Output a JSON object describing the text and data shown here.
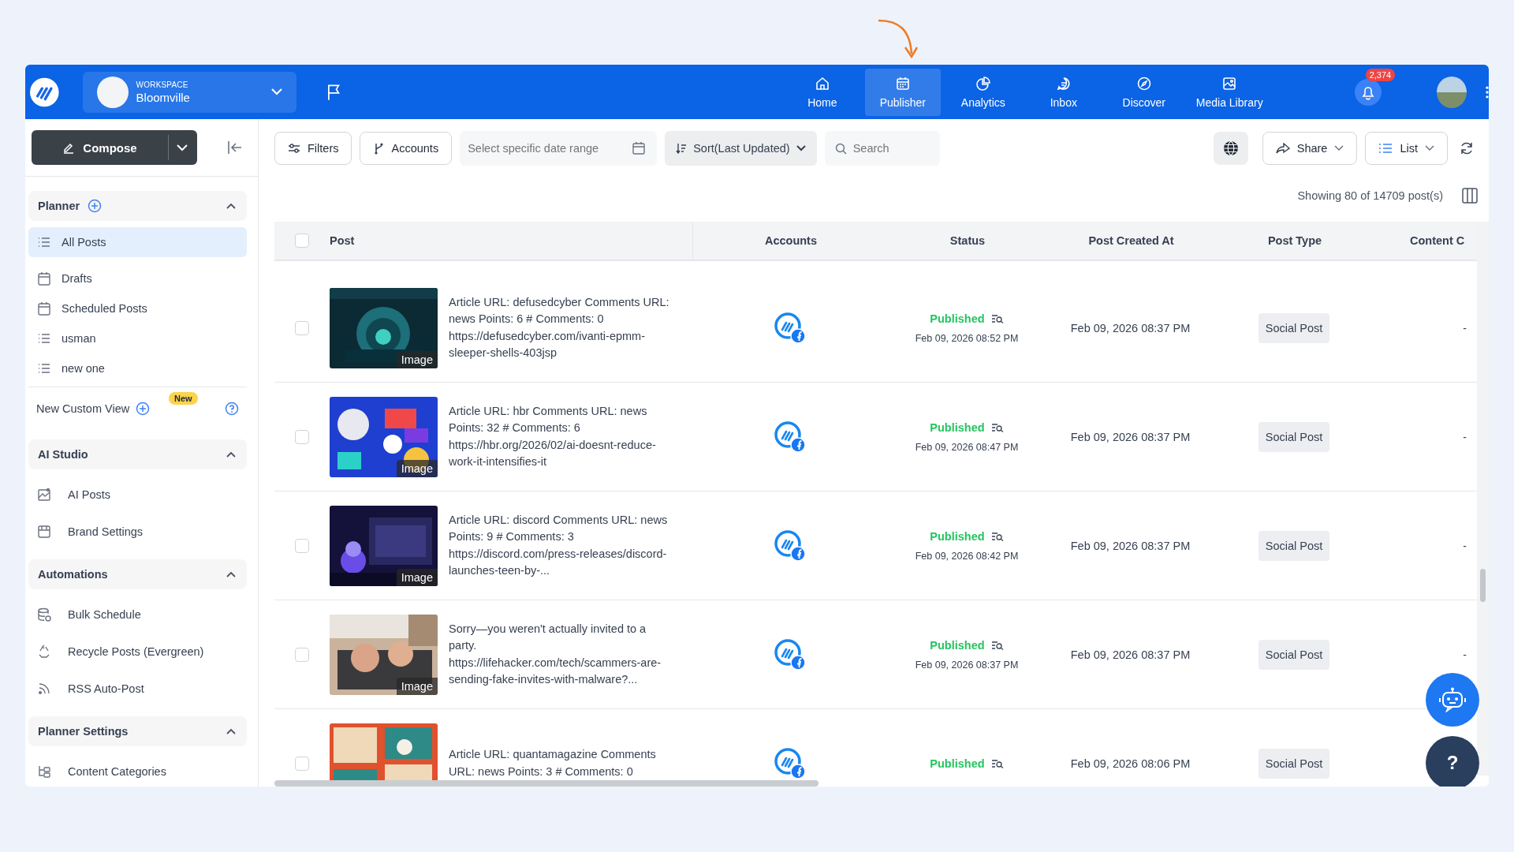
{
  "header": {
    "workspace_label": "WORKSPACE",
    "workspace_name": "Bloomville",
    "nav": [
      {
        "label": "Home",
        "selected": false
      },
      {
        "label": "Publisher",
        "selected": true
      },
      {
        "label": "Analytics",
        "selected": false
      },
      {
        "label": "Inbox",
        "selected": false
      },
      {
        "label": "Discover",
        "selected": false
      },
      {
        "label": "Media Library",
        "selected": false
      }
    ],
    "notification_count": "2,374"
  },
  "sidebar": {
    "compose": "Compose",
    "sections": [
      {
        "title": "Planner",
        "add": true,
        "expanded": true,
        "items": [
          {
            "label": "All Posts",
            "selected": true
          },
          {
            "label": "Drafts",
            "selected": false
          },
          {
            "label": "Scheduled Posts",
            "selected": false
          },
          {
            "label": "usman",
            "selected": false
          },
          {
            "label": "new one",
            "selected": false
          }
        ],
        "custom_view": {
          "label": "New Custom View",
          "badge": "New"
        }
      },
      {
        "title": "AI Studio",
        "add": false,
        "expanded": true,
        "items": [
          {
            "label": "AI Posts",
            "selected": false
          },
          {
            "label": "Brand Settings",
            "selected": false
          }
        ]
      },
      {
        "title": "Automations",
        "add": false,
        "expanded": true,
        "items": [
          {
            "label": "Bulk Schedule",
            "selected": false
          },
          {
            "label": "Recycle Posts (Evergreen)",
            "selected": false
          },
          {
            "label": "RSS Auto-Post",
            "selected": false
          }
        ]
      },
      {
        "title": "Planner Settings",
        "add": false,
        "expanded": true,
        "items": [
          {
            "label": "Content Categories",
            "selected": false
          }
        ]
      }
    ]
  },
  "toolbar": {
    "filters": "Filters",
    "accounts": "Accounts",
    "date_range": {
      "placeholder": "Select specific date range"
    },
    "sort": "Sort(Last Updated)",
    "search": {
      "placeholder": "Search"
    },
    "share": "Share",
    "view": "List"
  },
  "summary": "Showing 80 of 14709 post(s)",
  "table": {
    "select_all_checked": false,
    "columns": [
      "Post",
      "Accounts",
      "Status",
      "Post Created At",
      "Post Type",
      "Content C"
    ],
    "rows": [
      {
        "checked": false,
        "media_label": "Image",
        "text": "Article URL: defusedcyber Comments URL: news Points: 6 # Comments: 0 https://defusedcyber.com/ivanti-epmm-sleeper-shells-403jsp",
        "status": "Published",
        "status_time": "Feb 09, 2026 08:52 PM",
        "created_at": "Feb 09, 2026 08:37 PM",
        "post_type": "Social Post",
        "content_category": "-"
      },
      {
        "checked": false,
        "media_label": "Image",
        "text": "Article URL: hbr Comments URL: news Points: 32 # Comments: 6 https://hbr.org/2026/02/ai-doesnt-reduce-work-it-intensifies-it",
        "status": "Published",
        "status_time": "Feb 09, 2026 08:47 PM",
        "created_at": "Feb 09, 2026 08:37 PM",
        "post_type": "Social Post",
        "content_category": "-"
      },
      {
        "checked": false,
        "media_label": "Image",
        "text": "Article URL: discord Comments URL: news Points: 9 # Comments: 3 https://discord.com/press-releases/discord-launches-teen-by-...",
        "status": "Published",
        "status_time": "Feb 09, 2026 08:42 PM",
        "created_at": "Feb 09, 2026 08:37 PM",
        "post_type": "Social Post",
        "content_category": "-"
      },
      {
        "checked": false,
        "media_label": "Image",
        "text": "Sorry—you weren't actually invited to a party. https://lifehacker.com/tech/scammers-are-sending-fake-invites-with-malware?...",
        "status": "Published",
        "status_time": "Feb 09, 2026 08:37 PM",
        "created_at": "Feb 09, 2026 08:37 PM",
        "post_type": "Social Post",
        "content_category": "-"
      },
      {
        "checked": false,
        "text": "Article URL: quantamagazine Comments URL: news Points: 3 # Comments: 0",
        "status": "Published",
        "created_at": "Feb 09, 2026 08:06 PM",
        "post_type": "Social Post"
      }
    ]
  },
  "help_button": "?"
}
